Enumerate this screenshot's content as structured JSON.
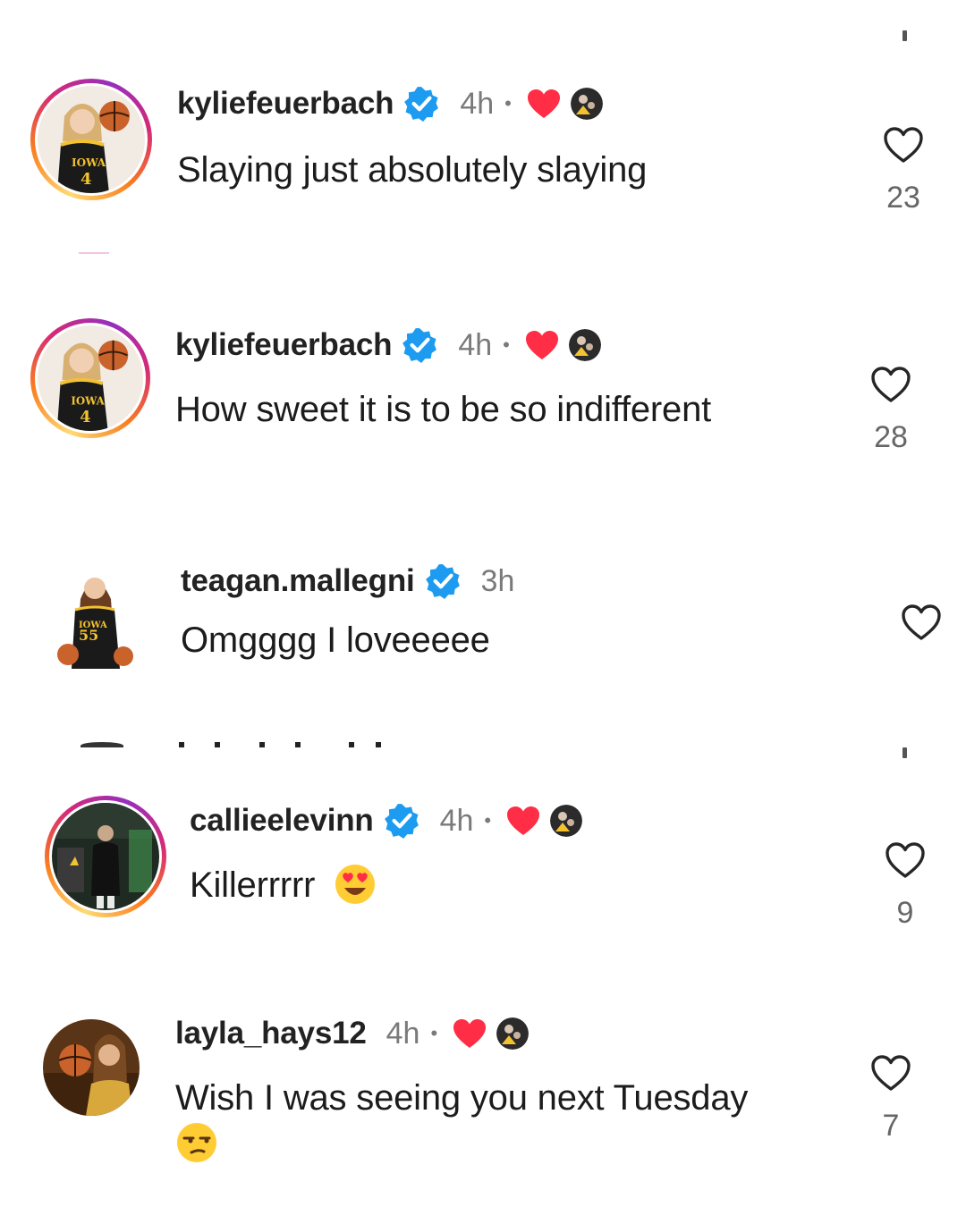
{
  "comments": [
    {
      "username": "kyliefeuerbach",
      "time": "4h",
      "dot": "•",
      "text": "Slaying just absolutely slaying",
      "likes": "23"
    },
    {
      "username": "kyliefeuerbach",
      "time": "4h",
      "dot": "•",
      "text": "How sweet it is to be so indifferent",
      "likes": "28"
    },
    {
      "username": "teagan.mallegni",
      "time": "3h",
      "text": "Omgggg I loveeeee",
      "likes": ""
    },
    {
      "username": "callieelevinn",
      "time": "4h",
      "dot": "•",
      "text": "Killerrrrr",
      "likes": "9"
    },
    {
      "username": "layla_hays12",
      "time": "4h",
      "dot": "•",
      "text": "Wish I was seeing you next Tuesday",
      "likes": "7"
    }
  ],
  "colors": {
    "verified": "#1d9bf0",
    "liked_heart": "#ff2d45",
    "iowa_gold": "#f2c230",
    "jersey_black": "#1a1a1a"
  },
  "icons": {
    "verified": "verified-badge-icon",
    "liked_by_author": "red-heart-icon",
    "like": "heart-outline-icon",
    "emoji_heart_eyes": "heart-eyes-emoji",
    "emoji_unamused": "unamused-face-emoji"
  }
}
